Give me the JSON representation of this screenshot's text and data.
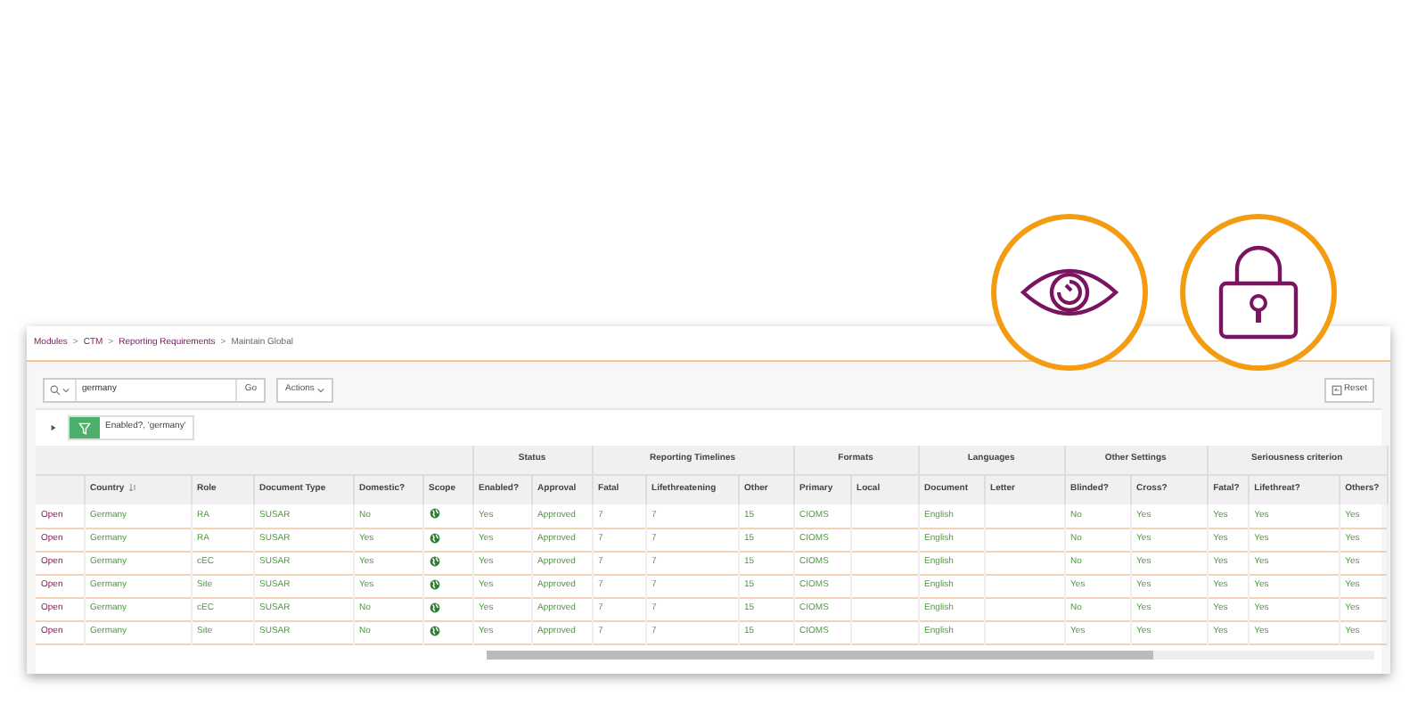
{
  "breadcrumb": [
    {
      "label": "Modules",
      "kind": "link"
    },
    {
      "separator_before": ">",
      "label": "CTM",
      "kind": "link"
    },
    {
      "separator_before": ">",
      "label": "Reporting Requirements",
      "kind": "link"
    },
    {
      "separator_before": ">",
      "label": "Maintain Global",
      "kind": "current"
    }
  ],
  "toolbar": {
    "search_value": "germany",
    "go": "Go",
    "actions": "Actions",
    "reset": "Reset"
  },
  "filter": {
    "text": "Enabled?, 'germany'"
  },
  "column_groups": [
    {
      "columns": [
        {
          "kind": "link"
        },
        {
          "label": "Country",
          "kind": "text",
          "sorted": true
        },
        {
          "label": "Role",
          "kind": "text",
          "sorted": false
        },
        {
          "label": "Document Type",
          "kind": "text",
          "sorted": false
        },
        {
          "label": "Domestic?",
          "kind": "text",
          "sorted": false
        },
        {
          "label": "Scope",
          "kind": "icon",
          "sorted": false
        }
      ]
    },
    {
      "label": "Status",
      "columns": [
        {
          "label": "Enabled?",
          "kind": "text",
          "sorted": false
        },
        {
          "label": "Approval",
          "kind": "text",
          "sorted": false
        }
      ]
    },
    {
      "label": "Reporting Timelines",
      "columns": [
        {
          "label": "Fatal",
          "kind": "text",
          "sorted": false
        },
        {
          "label": "Lifethreatening",
          "kind": "text",
          "sorted": false
        },
        {
          "label": "Other",
          "kind": "text",
          "sorted": false
        }
      ]
    },
    {
      "label": "Formats",
      "columns": [
        {
          "label": "Primary",
          "kind": "text",
          "sorted": false
        },
        {
          "label": "Local",
          "kind": "text",
          "sorted": false
        }
      ]
    },
    {
      "label": "Languages",
      "columns": [
        {
          "label": "Document",
          "kind": "text",
          "sorted": false
        },
        {
          "label": "Letter",
          "kind": "text",
          "sorted": false
        }
      ]
    },
    {
      "label": "Other Settings",
      "columns": [
        {
          "label": "Blinded?",
          "kind": "text",
          "sorted": false
        },
        {
          "label": "Cross?",
          "kind": "text",
          "sorted": false
        }
      ]
    },
    {
      "label": "Seriousness criterion",
      "columns": [
        {
          "label": "Fatal?",
          "kind": "text",
          "sorted": false
        },
        {
          "label": "Lifethreat?",
          "kind": "text",
          "sorted": false
        },
        {
          "label": "Others?",
          "kind": "text",
          "sorted": false
        }
      ]
    }
  ],
  "rows": [
    {
      "link": "Open",
      "cells": [
        "Germany",
        "RA",
        "SUSAR",
        "No",
        "Yes",
        "Approved",
        "7",
        "7",
        "15",
        "CIOMS",
        "",
        "English",
        "",
        "No",
        "Yes",
        "Yes",
        "Yes",
        "Yes"
      ]
    },
    {
      "link": "Open",
      "cells": [
        "Germany",
        "RA",
        "SUSAR",
        "Yes",
        "Yes",
        "Approved",
        "7",
        "7",
        "15",
        "CIOMS",
        "",
        "English",
        "",
        "No",
        "Yes",
        "Yes",
        "Yes",
        "Yes"
      ]
    },
    {
      "link": "Open",
      "cells": [
        "Germany",
        "cEC",
        "SUSAR",
        "Yes",
        "Yes",
        "Approved",
        "7",
        "7",
        "15",
        "CIOMS",
        "",
        "English",
        "",
        "No",
        "Yes",
        "Yes",
        "Yes",
        "Yes"
      ]
    },
    {
      "link": "Open",
      "cells": [
        "Germany",
        "Site",
        "SUSAR",
        "Yes",
        "Yes",
        "Approved",
        "7",
        "7",
        "15",
        "CIOMS",
        "",
        "English",
        "",
        "Yes",
        "Yes",
        "Yes",
        "Yes",
        "Yes"
      ]
    },
    {
      "link": "Open",
      "cells": [
        "Germany",
        "cEC",
        "SUSAR",
        "No",
        "Yes",
        "Approved",
        "7",
        "7",
        "15",
        "CIOMS",
        "",
        "English",
        "",
        "No",
        "Yes",
        "Yes",
        "Yes",
        "Yes"
      ]
    },
    {
      "link": "Open",
      "cells": [
        "Germany",
        "Site",
        "SUSAR",
        "No",
        "Yes",
        "Approved",
        "7",
        "7",
        "15",
        "CIOMS",
        "",
        "English",
        "",
        "Yes",
        "Yes",
        "Yes",
        "Yes",
        "Yes"
      ]
    }
  ]
}
